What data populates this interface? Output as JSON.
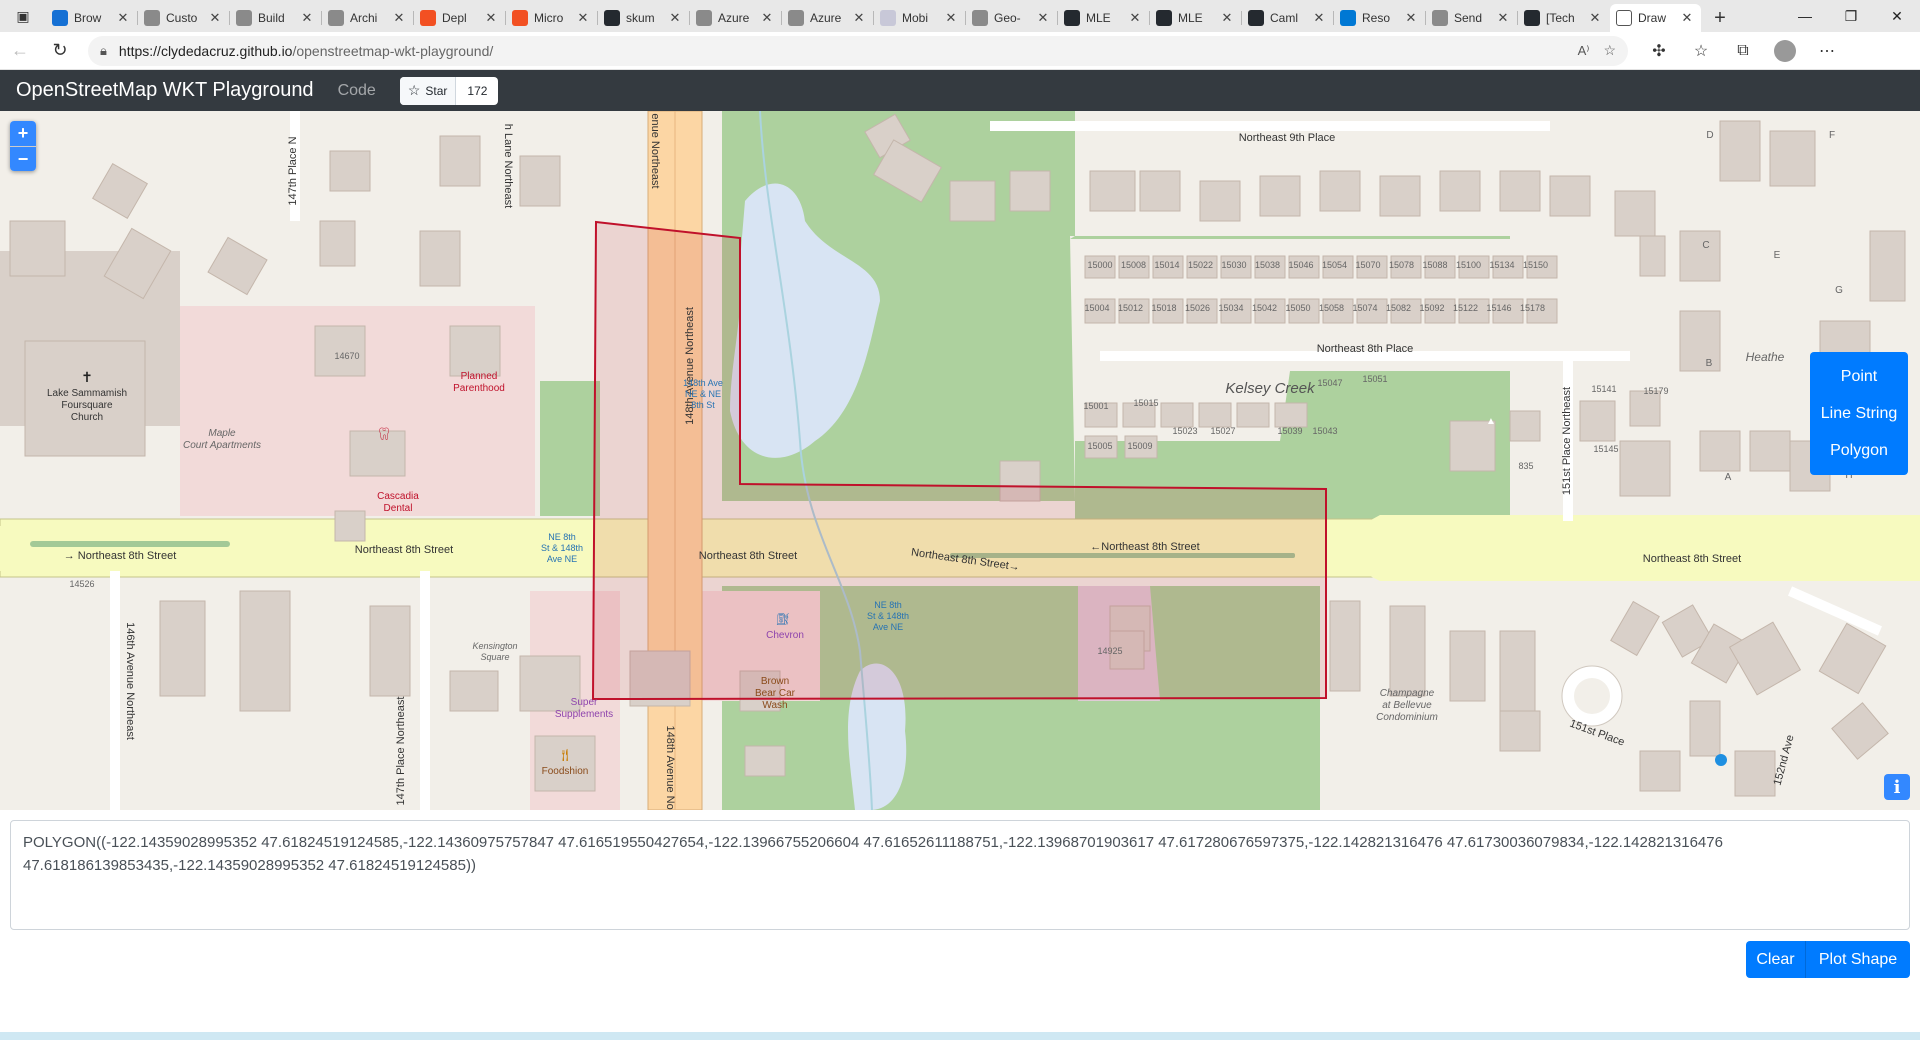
{
  "browser": {
    "tabs": [
      {
        "title": "Brow",
        "color": "#1570d4"
      },
      {
        "title": "Custo",
        "color": "#8a8a8a"
      },
      {
        "title": "Build",
        "color": "#8a8a8a"
      },
      {
        "title": "Archi",
        "color": "#8a8a8a"
      },
      {
        "title": "Depl",
        "color": "#f25022"
      },
      {
        "title": "Micro",
        "color": "#f25022"
      },
      {
        "title": "skum",
        "color": "#24292f"
      },
      {
        "title": "Azure",
        "color": "#8a8a8a"
      },
      {
        "title": "Azure",
        "color": "#8a8a8a"
      },
      {
        "title": "Mobi",
        "color": "#c8c8d8"
      },
      {
        "title": "Geo-",
        "color": "#8a8a8a"
      },
      {
        "title": "MLE",
        "color": "#24292f"
      },
      {
        "title": "MLE",
        "color": "#24292f"
      },
      {
        "title": "Caml",
        "color": "#24292f"
      },
      {
        "title": "Reso",
        "color": "#0078d4"
      },
      {
        "title": "Send",
        "color": "#8a8a8a"
      },
      {
        "title": "[Tech",
        "color": "#24292f"
      },
      {
        "title": "Draw",
        "color": "#ffffff",
        "active": true
      }
    ],
    "url_host": "https://clydedacruz.github.io",
    "url_path": "/openstreetmap-wkt-playground/"
  },
  "navbar": {
    "brand": "OpenStreetMap WKT Playground",
    "code_link": "Code",
    "star_label": "Star",
    "star_count": "172"
  },
  "map": {
    "zoom_in": "+",
    "zoom_out": "−",
    "info": "i",
    "labels": {
      "ne9th": "Northeast 9th Place",
      "ne8thPlace": "Northeast 8th Place",
      "kelsey": "Kelsey Creek",
      "ne8thSt": "Northeast 8th Street",
      "ne8thSt_mid": "Northeast 8th Street",
      "ne8thSt_pill": "←Northeast 8th Street",
      "ne8thSt_diag": "Northeast 8th Street→",
      "ne8thSt_west": "→ Northeast 8th Street",
      "ne8thSt_east": "Northeast 8th Street",
      "ave148": "148th Avenue Northeast",
      "ave148_south": "148th Avenue Nort",
      "ave148_north": "enue Northeast",
      "ave146": "146th Avenue Northeast",
      "pl147n": "147th Place N",
      "pl147s": "147th Place Northeast",
      "lane": "h Lane Northeast",
      "pl151": "151st Place Northeast",
      "pl151_loop": "151st Place",
      "ave152": "152nd Ave",
      "church": [
        "Lake Sammamish",
        "Foursquare",
        "Church"
      ],
      "maple": [
        "Maple",
        "Court Apartments"
      ],
      "planned": [
        "Planned",
        "Parenthood"
      ],
      "cascadia": [
        "Cascadia",
        "Dental"
      ],
      "kensington": [
        "Kensington",
        "Square"
      ],
      "super": [
        "Super",
        "Supplements"
      ],
      "foodshion": "Foodshion",
      "chevron": "Chevron",
      "brownbear": [
        "Brown",
        "Bear Car",
        "Wash"
      ],
      "busstop1": [
        "148th Ave",
        "NE & NE",
        "8th St"
      ],
      "busstop2": [
        "NE 8th",
        "St & 148th",
        "Ave NE"
      ],
      "busstop3": [
        "NE 8th",
        "St & 148th",
        "Ave NE"
      ],
      "champagne": [
        "Champagne",
        "at Bellevue",
        "Condominium"
      ],
      "heather": "Heathe",
      "num14670": "14670",
      "num14526": "14526",
      "num14925": "14925",
      "num835": "835",
      "num15141": "15141",
      "num15145": "15145",
      "num15179": "15179",
      "num15178": "15178",
      "letters": [
        "D",
        "F",
        "C",
        "E",
        "G",
        "B",
        "A",
        "H"
      ],
      "houses_row1": [
        "15000",
        "15008",
        "15014",
        "15022",
        "15030",
        "15038",
        "15046",
        "15054",
        "15070",
        "15078",
        "15088",
        "15100",
        "15134",
        "15150"
      ],
      "houses_row2": [
        "15004",
        "15012",
        "15018",
        "15026",
        "15034",
        "15042",
        "15050",
        "15058",
        "15074",
        "15082",
        "15092",
        "15122",
        "15146",
        "15178"
      ],
      "houses_row3": [
        "15001",
        "15015",
        "15023",
        "15027",
        "15039",
        "15043",
        "15047",
        "15051",
        "15005",
        "15009"
      ]
    }
  },
  "draw_tools": {
    "point": "Point",
    "linestring": "Line String",
    "polygon": "Polygon"
  },
  "wkt_text": "POLYGON((-122.14359028995352 47.61824519124585,-122.14360975757847 47.616519550427654,-122.13966755206604 47.61652611188751,-122.13968701903617 47.617280676597375,-122.142821316476 47.61730036079834,-122.142821316476 47.618186139853435,-122.14359028995352 47.61824519124585))",
  "buttons": {
    "clear": "Clear",
    "plot": "Plot Shape"
  },
  "colors": {
    "accent": "#007bff",
    "navbar": "#343a40",
    "polygon_stroke": "#c0112b"
  }
}
